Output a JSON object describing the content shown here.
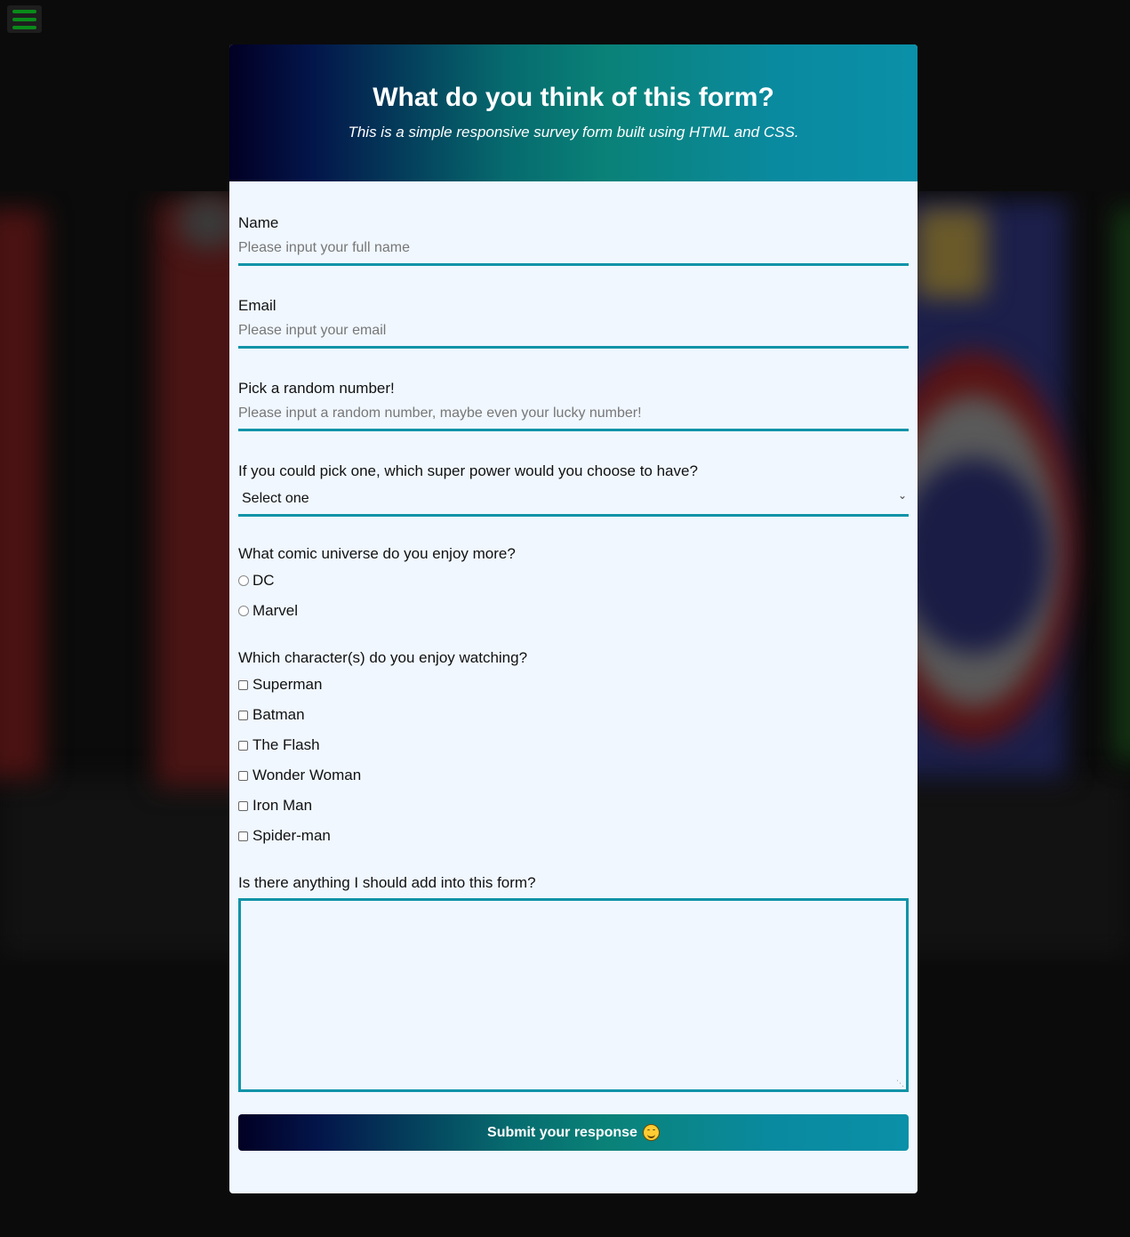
{
  "header": {
    "title": "What do you think of this form?",
    "description": "This is a simple responsive survey form built using HTML and CSS."
  },
  "menu": {
    "icon": "hamburger-menu-icon"
  },
  "fields": {
    "name": {
      "label": "Name",
      "placeholder": "Please input your full name"
    },
    "email": {
      "label": "Email",
      "placeholder": "Please input your email"
    },
    "number": {
      "label": "Pick a random number!",
      "placeholder": "Please input a random number, maybe even your lucky number!"
    },
    "superpower": {
      "label": "If you could pick one, which super power would you choose to have?",
      "selected": "Select one"
    },
    "universe": {
      "label": "What comic universe do you enjoy more?",
      "options": [
        "DC",
        "Marvel"
      ]
    },
    "characters": {
      "label": "Which character(s) do you enjoy watching?",
      "options": [
        "Superman",
        "Batman",
        "The Flash",
        "Wonder Woman",
        "Iron Man",
        "Spider-man"
      ]
    },
    "comments": {
      "label": "Is there anything I should add into this form?"
    }
  },
  "submit": {
    "label": "Submit your response",
    "icon": "smiling-face-emoji-icon"
  },
  "colors": {
    "accent": "#0f93a8",
    "header_gradient_start": "#020024",
    "header_gradient_end": "#0a90a8",
    "menu_icon": "#0a8a1a",
    "card_bg": "#f0f7ff"
  }
}
